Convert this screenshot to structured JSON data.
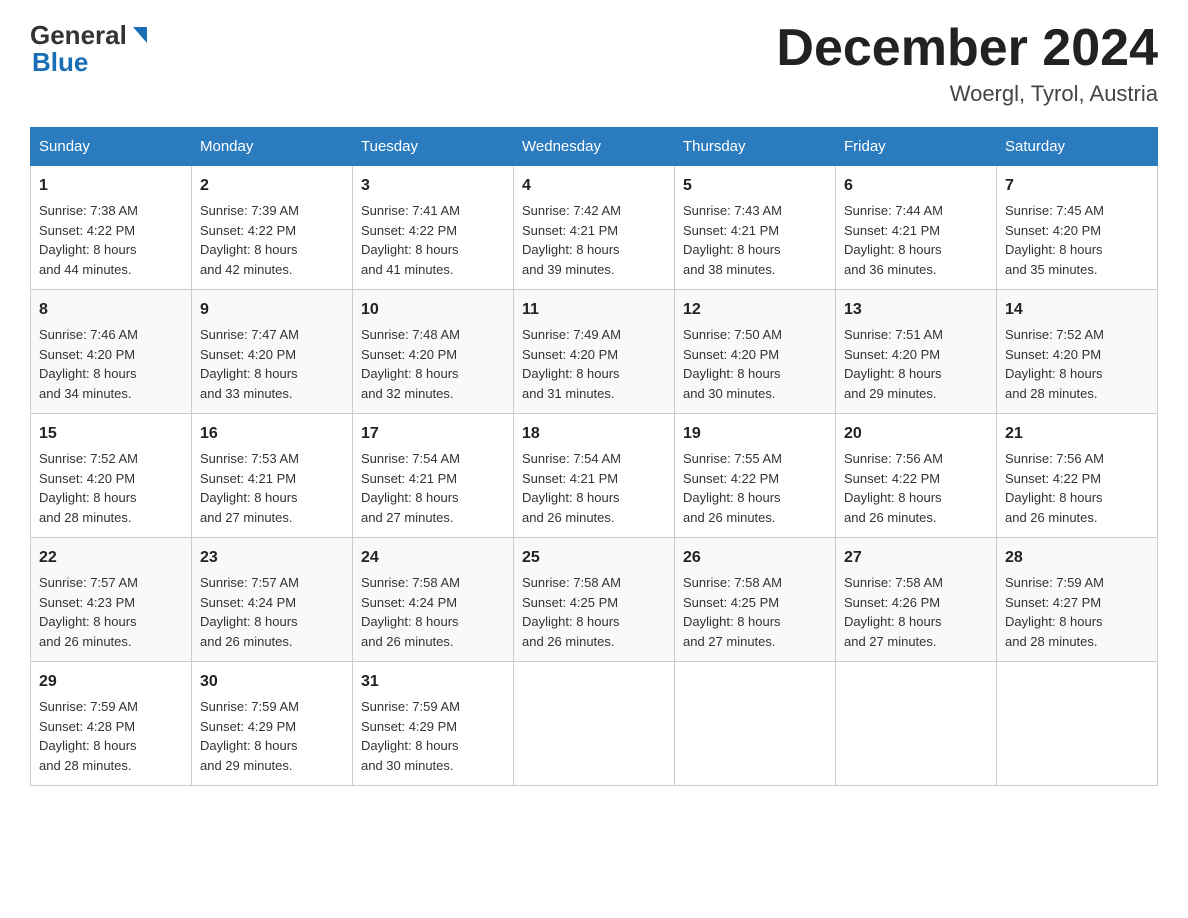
{
  "header": {
    "logo_general": "General",
    "logo_blue": "Blue",
    "month_title": "December 2024",
    "location": "Woergl, Tyrol, Austria"
  },
  "weekdays": [
    "Sunday",
    "Monday",
    "Tuesday",
    "Wednesday",
    "Thursday",
    "Friday",
    "Saturday"
  ],
  "weeks": [
    [
      {
        "day": "1",
        "sunrise": "7:38 AM",
        "sunset": "4:22 PM",
        "daylight": "8 hours and 44 minutes."
      },
      {
        "day": "2",
        "sunrise": "7:39 AM",
        "sunset": "4:22 PM",
        "daylight": "8 hours and 42 minutes."
      },
      {
        "day": "3",
        "sunrise": "7:41 AM",
        "sunset": "4:22 PM",
        "daylight": "8 hours and 41 minutes."
      },
      {
        "day": "4",
        "sunrise": "7:42 AM",
        "sunset": "4:21 PM",
        "daylight": "8 hours and 39 minutes."
      },
      {
        "day": "5",
        "sunrise": "7:43 AM",
        "sunset": "4:21 PM",
        "daylight": "8 hours and 38 minutes."
      },
      {
        "day": "6",
        "sunrise": "7:44 AM",
        "sunset": "4:21 PM",
        "daylight": "8 hours and 36 minutes."
      },
      {
        "day": "7",
        "sunrise": "7:45 AM",
        "sunset": "4:20 PM",
        "daylight": "8 hours and 35 minutes."
      }
    ],
    [
      {
        "day": "8",
        "sunrise": "7:46 AM",
        "sunset": "4:20 PM",
        "daylight": "8 hours and 34 minutes."
      },
      {
        "day": "9",
        "sunrise": "7:47 AM",
        "sunset": "4:20 PM",
        "daylight": "8 hours and 33 minutes."
      },
      {
        "day": "10",
        "sunrise": "7:48 AM",
        "sunset": "4:20 PM",
        "daylight": "8 hours and 32 minutes."
      },
      {
        "day": "11",
        "sunrise": "7:49 AM",
        "sunset": "4:20 PM",
        "daylight": "8 hours and 31 minutes."
      },
      {
        "day": "12",
        "sunrise": "7:50 AM",
        "sunset": "4:20 PM",
        "daylight": "8 hours and 30 minutes."
      },
      {
        "day": "13",
        "sunrise": "7:51 AM",
        "sunset": "4:20 PM",
        "daylight": "8 hours and 29 minutes."
      },
      {
        "day": "14",
        "sunrise": "7:52 AM",
        "sunset": "4:20 PM",
        "daylight": "8 hours and 28 minutes."
      }
    ],
    [
      {
        "day": "15",
        "sunrise": "7:52 AM",
        "sunset": "4:20 PM",
        "daylight": "8 hours and 28 minutes."
      },
      {
        "day": "16",
        "sunrise": "7:53 AM",
        "sunset": "4:21 PM",
        "daylight": "8 hours and 27 minutes."
      },
      {
        "day": "17",
        "sunrise": "7:54 AM",
        "sunset": "4:21 PM",
        "daylight": "8 hours and 27 minutes."
      },
      {
        "day": "18",
        "sunrise": "7:54 AM",
        "sunset": "4:21 PM",
        "daylight": "8 hours and 26 minutes."
      },
      {
        "day": "19",
        "sunrise": "7:55 AM",
        "sunset": "4:22 PM",
        "daylight": "8 hours and 26 minutes."
      },
      {
        "day": "20",
        "sunrise": "7:56 AM",
        "sunset": "4:22 PM",
        "daylight": "8 hours and 26 minutes."
      },
      {
        "day": "21",
        "sunrise": "7:56 AM",
        "sunset": "4:22 PM",
        "daylight": "8 hours and 26 minutes."
      }
    ],
    [
      {
        "day": "22",
        "sunrise": "7:57 AM",
        "sunset": "4:23 PM",
        "daylight": "8 hours and 26 minutes."
      },
      {
        "day": "23",
        "sunrise": "7:57 AM",
        "sunset": "4:24 PM",
        "daylight": "8 hours and 26 minutes."
      },
      {
        "day": "24",
        "sunrise": "7:58 AM",
        "sunset": "4:24 PM",
        "daylight": "8 hours and 26 minutes."
      },
      {
        "day": "25",
        "sunrise": "7:58 AM",
        "sunset": "4:25 PM",
        "daylight": "8 hours and 26 minutes."
      },
      {
        "day": "26",
        "sunrise": "7:58 AM",
        "sunset": "4:25 PM",
        "daylight": "8 hours and 27 minutes."
      },
      {
        "day": "27",
        "sunrise": "7:58 AM",
        "sunset": "4:26 PM",
        "daylight": "8 hours and 27 minutes."
      },
      {
        "day": "28",
        "sunrise": "7:59 AM",
        "sunset": "4:27 PM",
        "daylight": "8 hours and 28 minutes."
      }
    ],
    [
      {
        "day": "29",
        "sunrise": "7:59 AM",
        "sunset": "4:28 PM",
        "daylight": "8 hours and 28 minutes."
      },
      {
        "day": "30",
        "sunrise": "7:59 AM",
        "sunset": "4:29 PM",
        "daylight": "8 hours and 29 minutes."
      },
      {
        "day": "31",
        "sunrise": "7:59 AM",
        "sunset": "4:29 PM",
        "daylight": "8 hours and 30 minutes."
      },
      null,
      null,
      null,
      null
    ]
  ],
  "labels": {
    "sunrise": "Sunrise:",
    "sunset": "Sunset:",
    "daylight": "Daylight:"
  }
}
